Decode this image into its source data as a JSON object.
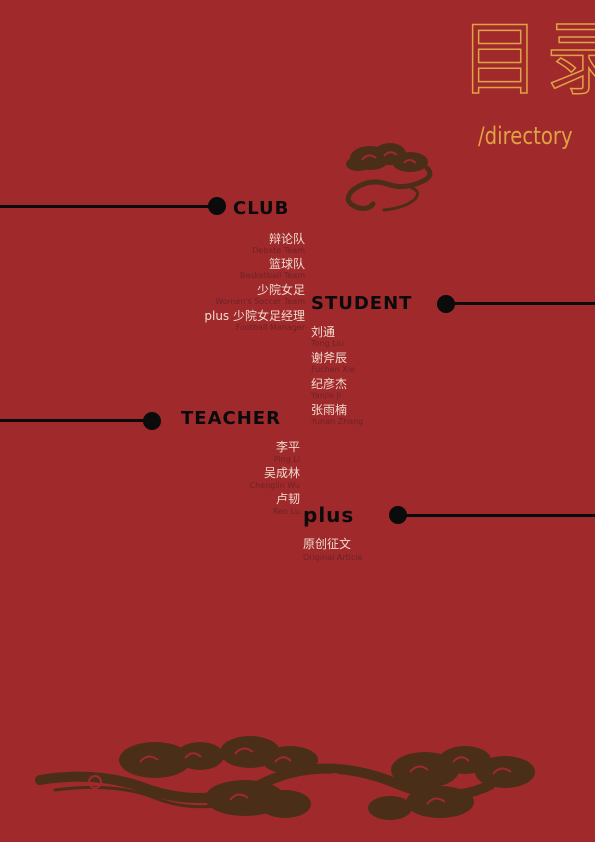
{
  "title": {
    "cn": "目录",
    "en": "/directory"
  },
  "sections": {
    "club": {
      "heading": "CLUB",
      "items": [
        {
          "cn": "辩论队",
          "en": "Debate Team"
        },
        {
          "cn": "篮球队",
          "en": "Basketball Team"
        },
        {
          "cn": "少院女足",
          "en": "Women's Soccer Team"
        },
        {
          "cn": "plus  少院女足经理",
          "en": "Football Manager"
        }
      ]
    },
    "student": {
      "heading": "STUDENT",
      "items": [
        {
          "cn": "刘通",
          "en": "Tong Liu"
        },
        {
          "cn": "谢斧辰",
          "en": "Fuchen Xie"
        },
        {
          "cn": "纪彦杰",
          "en": "Yanjie Ji"
        },
        {
          "cn": "张雨楠",
          "en": "Yunan Zhang"
        }
      ]
    },
    "teacher": {
      "heading": "TEACHER",
      "items": [
        {
          "cn": "李平",
          "en": "Ping Li"
        },
        {
          "cn": "吴成林",
          "en": "Chenglin Wu"
        },
        {
          "cn": "卢韧",
          "en": "Ren Lu"
        }
      ]
    },
    "plus": {
      "heading": "plus",
      "items": [
        {
          "cn": "原创征文",
          "en": "Original Article"
        }
      ]
    }
  },
  "colors": {
    "background": "#a0292c",
    "accent_gold": "#e0a244",
    "ink": "#0b0b0b",
    "cloud": "#4a2e18"
  },
  "decorations": [
    "cloud-top-icon",
    "cloud-bottom-icon"
  ]
}
